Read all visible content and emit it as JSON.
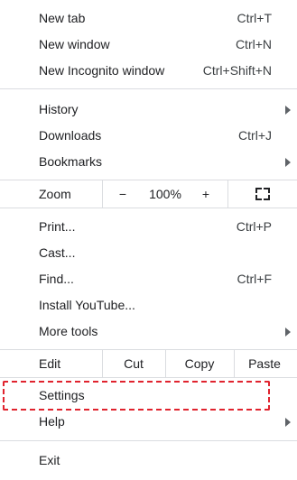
{
  "menu": {
    "group1": [
      {
        "label": "New tab",
        "shortcut": "Ctrl+T"
      },
      {
        "label": "New window",
        "shortcut": "Ctrl+N"
      },
      {
        "label": "New Incognito window",
        "shortcut": "Ctrl+Shift+N"
      }
    ],
    "group2": [
      {
        "label": "History",
        "has_submenu": true
      },
      {
        "label": "Downloads",
        "shortcut": "Ctrl+J"
      },
      {
        "label": "Bookmarks",
        "has_submenu": true
      }
    ],
    "zoom": {
      "label": "Zoom",
      "minus": "−",
      "level": "100%",
      "plus": "+",
      "fullscreen_icon": "fullscreen-icon"
    },
    "group3": [
      {
        "label": "Print...",
        "shortcut": "Ctrl+P"
      },
      {
        "label": "Cast..."
      },
      {
        "label": "Find...",
        "shortcut": "Ctrl+F"
      },
      {
        "label": "Install YouTube..."
      },
      {
        "label": "More tools",
        "has_submenu": true
      }
    ],
    "edit": {
      "label": "Edit",
      "cut": "Cut",
      "copy": "Copy",
      "paste": "Paste"
    },
    "group4": [
      {
        "label": "Settings",
        "highlighted": true
      },
      {
        "label": "Help",
        "has_submenu": true
      }
    ],
    "group5": [
      {
        "label": "Exit"
      }
    ]
  },
  "colors": {
    "highlight_border": "#e0232e",
    "separator": "#dadce0",
    "text": "#202124"
  }
}
